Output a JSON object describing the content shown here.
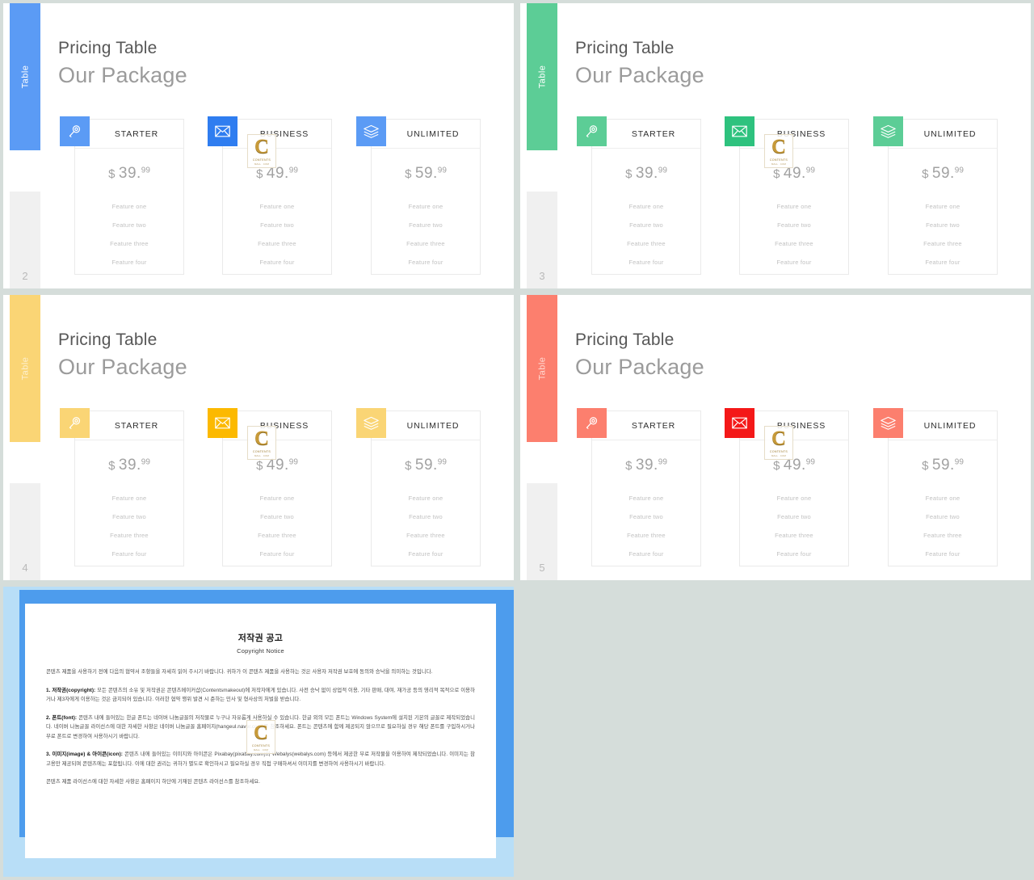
{
  "theme": {
    "page_background": "#d5ddda",
    "slide_background": "#ffffff"
  },
  "slides": [
    {
      "number": "2",
      "tab_label": "Table",
      "accent": "#5b9bf5",
      "accent_strong": "#2f7df0",
      "kicker": "Pricing Table",
      "headline": "Our Package",
      "cards": [
        {
          "icon": "magnifier-icon",
          "title": "STARTER",
          "currency": "$",
          "amount": "39.",
          "cents": "99",
          "features": [
            "Feature one",
            "Feature two",
            "Feature three",
            "Feature four"
          ]
        },
        {
          "icon": "envelope-icon",
          "title": "BUSINESS",
          "currency": "$",
          "amount": "49.",
          "cents": "99",
          "features": [
            "Feature one",
            "Feature two",
            "Feature three",
            "Feature four"
          ]
        },
        {
          "icon": "layers-icon",
          "title": "UNLIMITED",
          "currency": "$",
          "amount": "59.",
          "cents": "99",
          "features": [
            "Feature one",
            "Feature two",
            "Feature three",
            "Feature four"
          ]
        }
      ]
    },
    {
      "number": "3",
      "tab_label": "Table",
      "accent": "#5ccd96",
      "accent_strong": "#2ec27e",
      "kicker": "Pricing Table",
      "headline": "Our Package",
      "cards": [
        {
          "icon": "magnifier-icon",
          "title": "STARTER",
          "currency": "$",
          "amount": "39.",
          "cents": "99",
          "features": [
            "Feature one",
            "Feature two",
            "Feature three",
            "Feature four"
          ]
        },
        {
          "icon": "envelope-icon",
          "title": "BUSINESS",
          "currency": "$",
          "amount": "49.",
          "cents": "99",
          "features": [
            "Feature one",
            "Feature two",
            "Feature three",
            "Feature four"
          ]
        },
        {
          "icon": "layers-icon",
          "title": "UNLIMITED",
          "currency": "$",
          "amount": "59.",
          "cents": "99",
          "features": [
            "Feature one",
            "Feature two",
            "Feature three",
            "Feature four"
          ]
        }
      ]
    },
    {
      "number": "4",
      "tab_label": "Table",
      "accent": "#fad575",
      "accent_strong": "#fcb900",
      "kicker": "Pricing Table",
      "headline": "Our Package",
      "cards": [
        {
          "icon": "magnifier-icon",
          "title": "STARTER",
          "currency": "$",
          "amount": "39.",
          "cents": "99",
          "features": [
            "Feature one",
            "Feature two",
            "Feature three",
            "Feature four"
          ]
        },
        {
          "icon": "envelope-icon",
          "title": "BUSINESS",
          "currency": "$",
          "amount": "49.",
          "cents": "99",
          "features": [
            "Feature one",
            "Feature two",
            "Feature three",
            "Feature four"
          ]
        },
        {
          "icon": "layers-icon",
          "title": "UNLIMITED",
          "currency": "$",
          "amount": "59.",
          "cents": "99",
          "features": [
            "Feature one",
            "Feature two",
            "Feature three",
            "Feature four"
          ]
        }
      ]
    },
    {
      "number": "5",
      "tab_label": "Table",
      "accent": "#fc7f6e",
      "accent_strong": "#f41818",
      "kicker": "Pricing Table",
      "headline": "Our Package",
      "cards": [
        {
          "icon": "magnifier-icon",
          "title": "STARTER",
          "currency": "$",
          "amount": "39.",
          "cents": "99",
          "features": [
            "Feature one",
            "Feature two",
            "Feature three",
            "Feature four"
          ]
        },
        {
          "icon": "envelope-icon",
          "title": "BUSINESS",
          "currency": "$",
          "amount": "49.",
          "cents": "99",
          "features": [
            "Feature one",
            "Feature two",
            "Feature three",
            "Feature four"
          ]
        },
        {
          "icon": "layers-icon",
          "title": "UNLIMITED",
          "currency": "$",
          "amount": "59.",
          "cents": "99",
          "features": [
            "Feature one",
            "Feature two",
            "Feature three",
            "Feature four"
          ]
        }
      ]
    }
  ],
  "watermark": {
    "letter": "C",
    "line1": "CONTENTS",
    "line2": "MALL . COM"
  },
  "copyright_slide": {
    "frame_color": "#4d9ced",
    "backdrop_color": "#b8def7",
    "title": "저작권 공고",
    "subtitle": "Copyright Notice",
    "intro": "콘텐츠 제품을 사용하기 전에 다음의 협약서 조항들을 자세히 읽어 주시기 바랍니다. 귀하가 이 콘텐츠 제품을 사용하는 것은 사용자 저작권 보호에 동의와 승낙을 의미하는 것입니다.",
    "section1_label": "1. 저작권(copyright):",
    "section1_text": "모든 콘텐츠의 소유 및 저작권은 콘텐츠메이커샵(Contentsmakeout)에 저작자에게 있습니다. 사전 승낙 없이 상업적 이용, 기타 판매, 대여, 재가공 등의 영리적 목적으로 이용하거나 제3자에게 이용하는 것은 금지되어 있습니다. 이러한 협약 행위 발견 시 준하는 민사 및 형사상의 처벌을 받습니다.",
    "section2_label": "2. 폰트(font):",
    "section2_text": "콘텐츠 내에 들어있는 한글 폰트는 네이버 나눔글꼴의 저작물로 누구나 자유롭게 사용하실 수 있습니다. 한글 외의 모든 폰트는 Windows System에 설치된 기본의 글꼴로 제작되었습니다. 네이버 나눔글꼴 라이선스에 대한 자세한 사항은 네이버 나눔글꼴 홈페이지(hangeul.naver.com)를 참조하세요. 폰트는 콘텐츠에 함께 제공되지 않으므로 필요하실 경우 해당 폰트를 구입하시거나 무료 폰트로 변경하여 사용하시기 바랍니다.",
    "section3_label": "3. 이미지(image) & 아이콘(icon):",
    "section3_text": "콘텐츠 내에 들어있는 이미지와 아이콘은 Pixabay(pixabay.com)와 Webalys(webalys.com) 등에서 제공한 무료 저작물을 이용하여 제작되었습니다. 이미지는 참고용만 제공되며 콘텐츠에는 포함됩니다. 이에 대한 권리는 귀하가 별도로 확인하시고 필요하실 경우 직접 구매하셔서 이미지를 변경하여 사용하시기 바랍니다.",
    "closing": "콘텐츠 제품 라이선스에 대한 자세한 사항은 홈페이지 하단에 기재된 콘텐츠 라이선스를 참조하세요."
  }
}
